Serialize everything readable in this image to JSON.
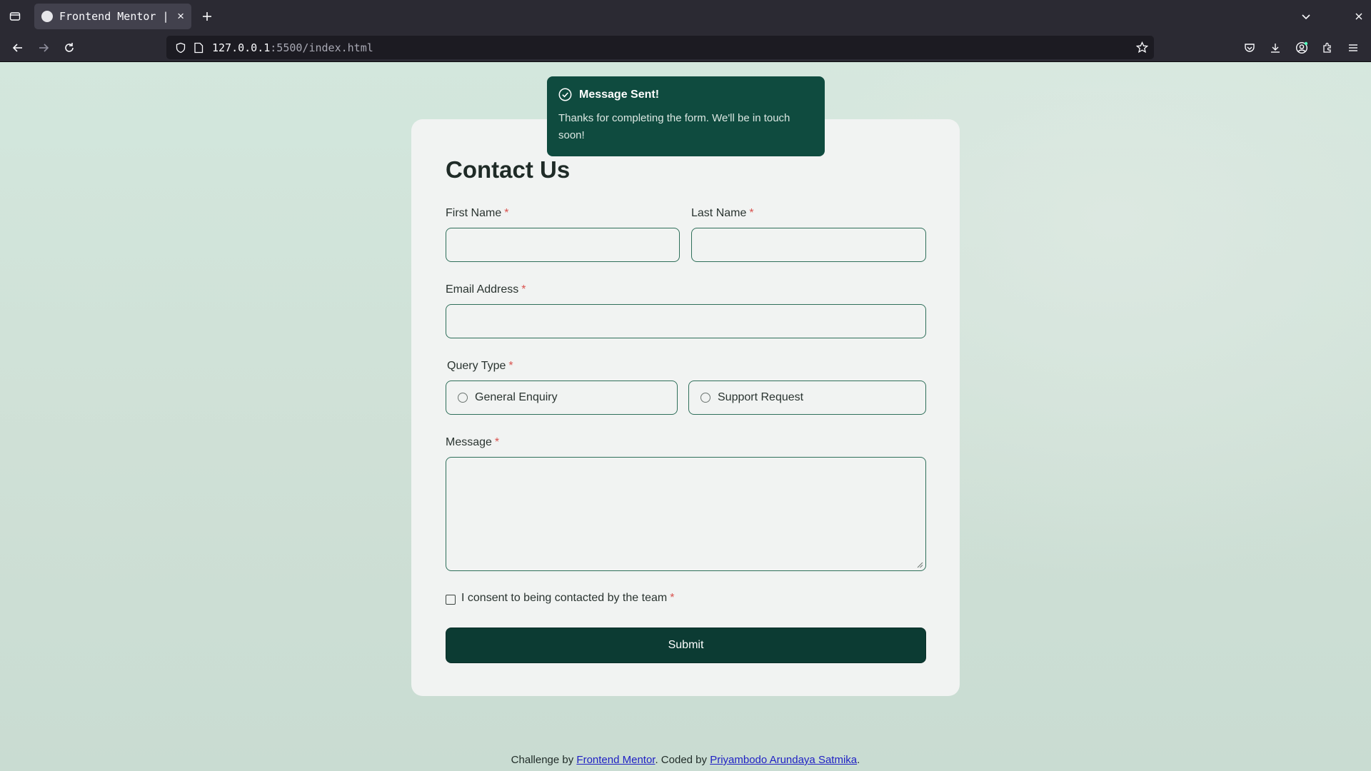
{
  "browser": {
    "tab_title": "Frontend Mentor |",
    "url_host": "127.0.0.1",
    "url_rest": ":5500/index.html"
  },
  "toast": {
    "title": "Message Sent!",
    "body": "Thanks for completing the form. We'll be in touch soon!"
  },
  "form": {
    "title": "Contact Us",
    "first_name_label": "First Name",
    "last_name_label": "Last Name",
    "email_label": "Email Address",
    "query_type_label": "Query Type",
    "query_options": [
      "General Enquiry",
      "Support Request"
    ],
    "message_label": "Message",
    "consent_label": "I consent to being contacted by the team",
    "required_mark": "*",
    "submit_label": "Submit",
    "first_name_value": "",
    "last_name_value": "",
    "email_value": ""
  },
  "footer": {
    "prefix": "Challenge by ",
    "link1": "Frontend Mentor",
    "middle": ". Coded by ",
    "link2": "Priyambodo Arundaya Satmika",
    "suffix": "."
  },
  "colors": {
    "accent": "#0c3b33",
    "toast_bg": "#0f4b3f",
    "field_border": "#2f6f5a",
    "required": "#d9534f"
  }
}
